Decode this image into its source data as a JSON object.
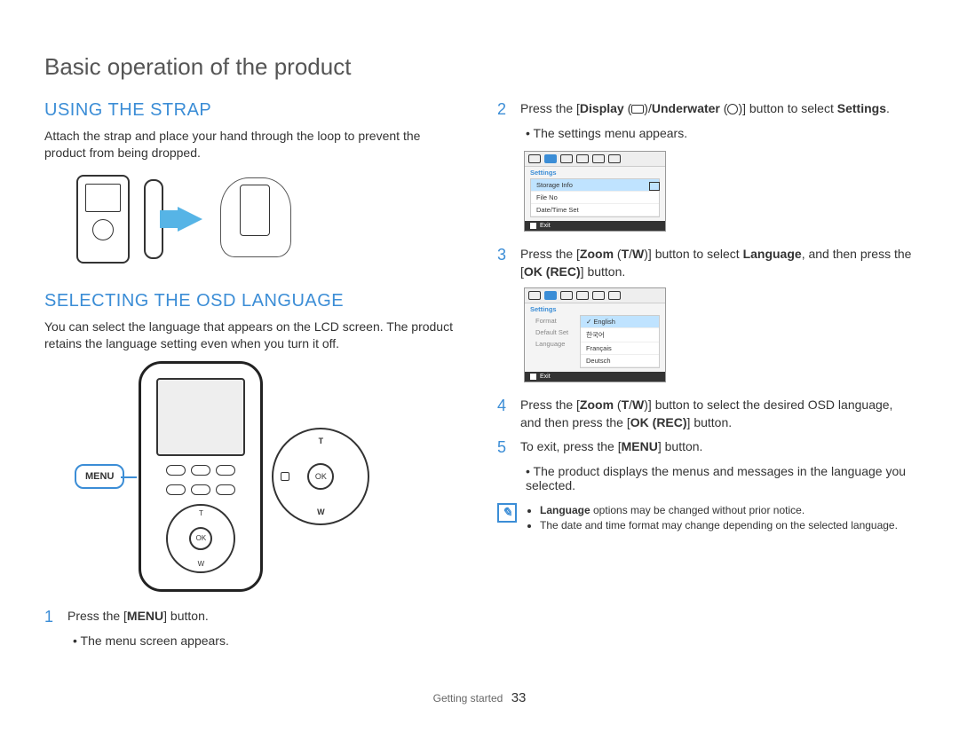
{
  "page_title": "Basic operation of the product",
  "left": {
    "strap_heading": "USING THE STRAP",
    "strap_body": "Attach the strap and place your hand through the loop to prevent the product from being dropped.",
    "osd_heading": "SELECTING THE OSD LANGUAGE",
    "osd_body": "You can select the language that appears on the LCD screen. The product retains the language setting even when you turn it off.",
    "menu_bubble": "MENU",
    "dpad": {
      "ok": "OK",
      "t": "T",
      "w": "W"
    },
    "step1_num": "1",
    "step1_pre": "Press the [",
    "step1_bold": "MENU",
    "step1_post": "] button.",
    "step1_bullet": "The menu screen appears."
  },
  "right": {
    "step2_num": "2",
    "step2_a": "Press the [",
    "step2_b": "Display",
    "step2_c": " (",
    "step2_d": ")/",
    "step2_e": "Underwater",
    "step2_f": " (",
    "step2_g": ")] button to select ",
    "step2_h": "Settings",
    "step2_i": ".",
    "step2_bullet": "The settings menu appears.",
    "osd1": {
      "tab": "Settings",
      "items": [
        "Storage Info",
        "File No",
        "Date/Time Set"
      ],
      "exit": "Exit"
    },
    "step3_num": "3",
    "step3_a": "Press the [",
    "step3_b": "Zoom",
    "step3_c": " (",
    "step3_d": "T",
    "step3_e": "/",
    "step3_f": "W",
    "step3_g": ")] button to select ",
    "step3_h": "Language",
    "step3_i": ", and then press the [",
    "step3_j": "OK (REC)",
    "step3_k": "] button.",
    "osd2": {
      "tab": "Settings",
      "left_items": [
        "Format",
        "Default Set",
        "Language"
      ],
      "lang_items": [
        "English",
        "한국어",
        "Français",
        "Deutsch"
      ],
      "exit": "Exit"
    },
    "step4_num": "4",
    "step4_a": "Press the [",
    "step4_b": "Zoom",
    "step4_c": " (",
    "step4_d": "T",
    "step4_e": "/",
    "step4_f": "W",
    "step4_g": ")] button to select the desired OSD language, and then press the [",
    "step4_h": "OK (REC)",
    "step4_i": "] button.",
    "step5_num": "5",
    "step5_a": "To exit, press the [",
    "step5_b": "MENU",
    "step5_c": "] button.",
    "step5_bullet": "The product displays the menus and messages in the language you selected.",
    "notes": {
      "n1a": "Language",
      "n1b": " options may be changed without prior notice.",
      "n2": "The date and time format may change depending on the selected language."
    }
  },
  "footer": {
    "section": "Getting started",
    "page": "33"
  }
}
